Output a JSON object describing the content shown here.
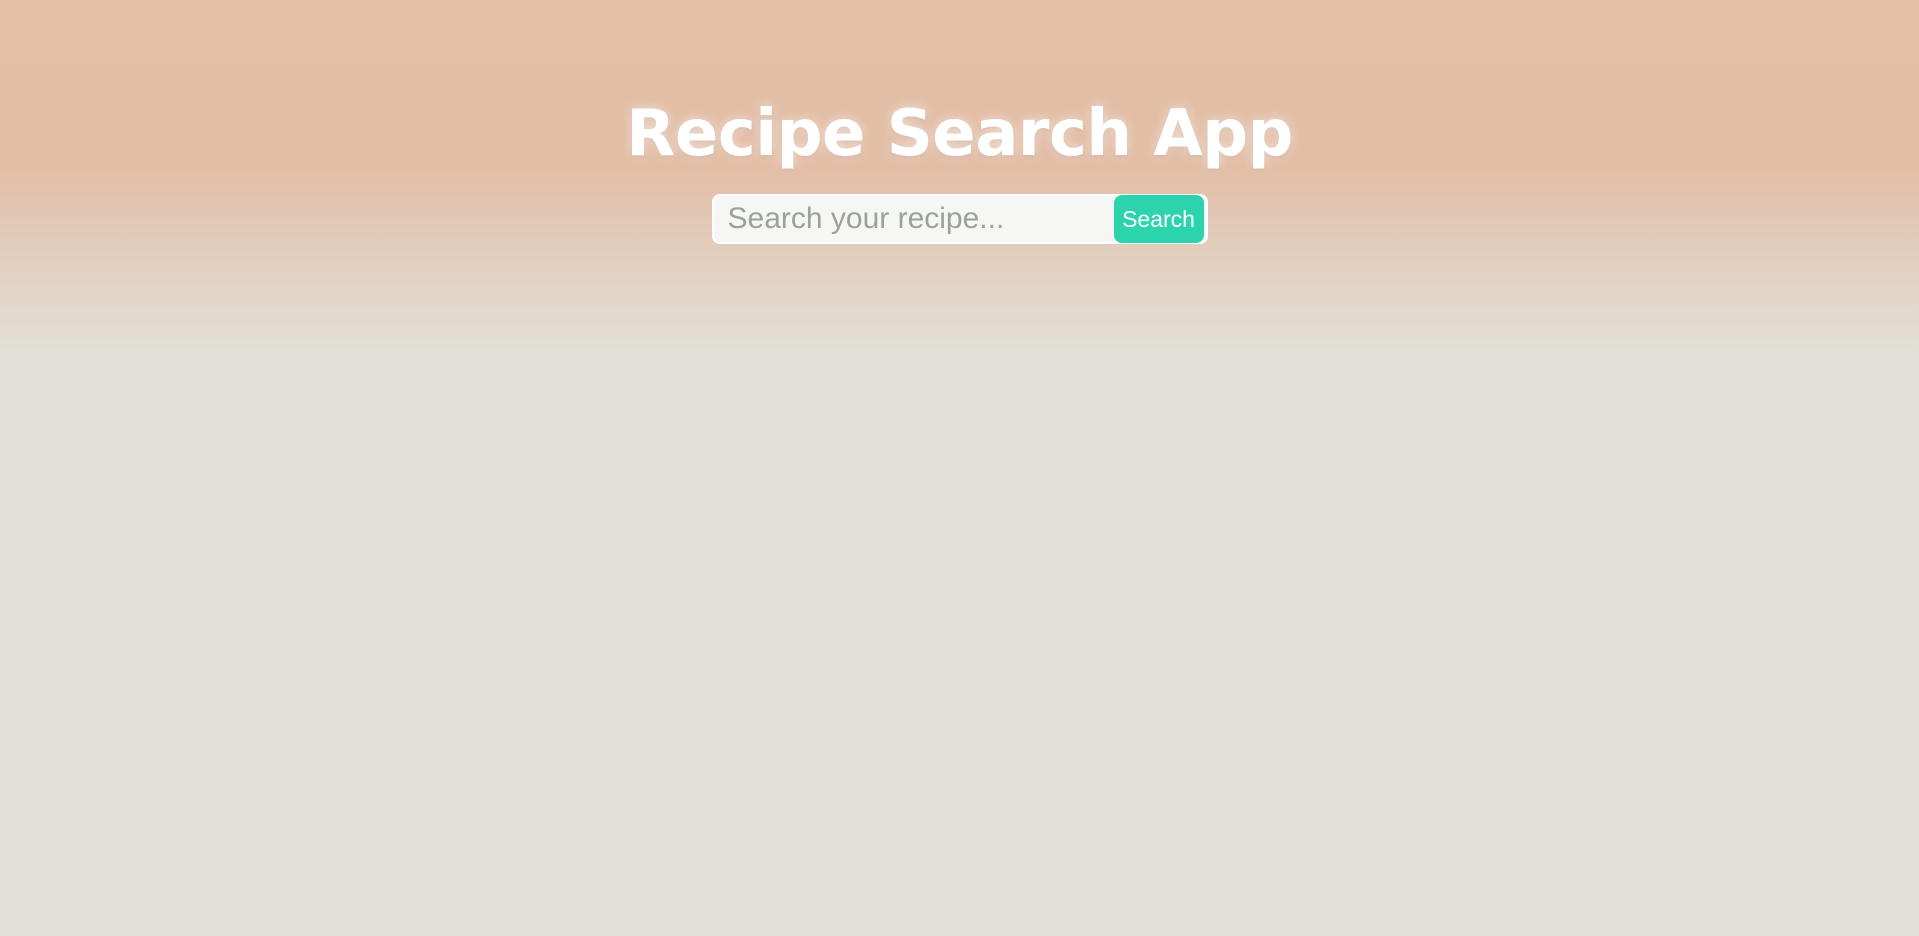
{
  "header": {
    "title": "Recipe Search App"
  },
  "search": {
    "placeholder": "Search your recipe...",
    "value": "",
    "button_label": "Search"
  },
  "colors": {
    "accent": "#2bd4ad",
    "title_text": "#ffffff",
    "background_top": "#e3bfa6",
    "background_bottom": "#e1e1d9"
  }
}
